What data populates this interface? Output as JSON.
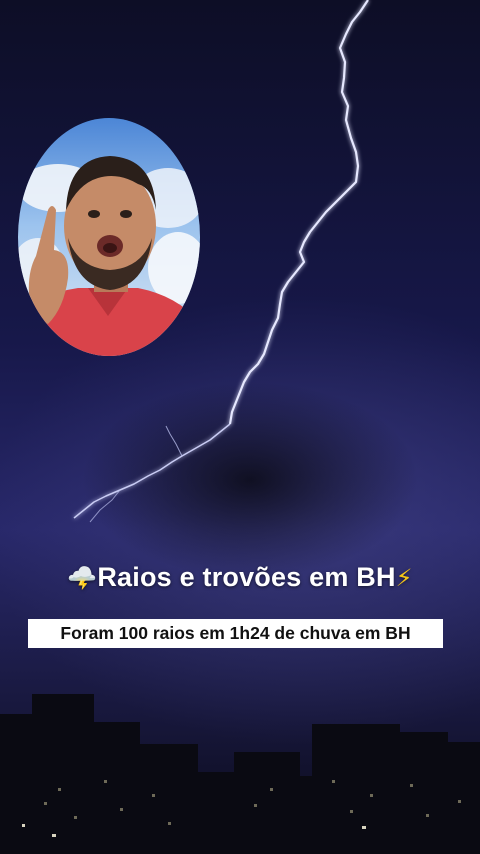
{
  "overlay": {
    "title_emoji_left": "🌩️",
    "title_text": "Raios e trovões em BH",
    "title_emoji_right": "⚡",
    "caption": "Foram 100 raios em 1h24 de chuva em BH"
  },
  "colors": {
    "sky_dark": "#0d0e26",
    "sky_glow": "#28286a",
    "lightning": "#e6e8ff",
    "caption_bg": "#ffffff",
    "shirt": "#d9434a"
  }
}
